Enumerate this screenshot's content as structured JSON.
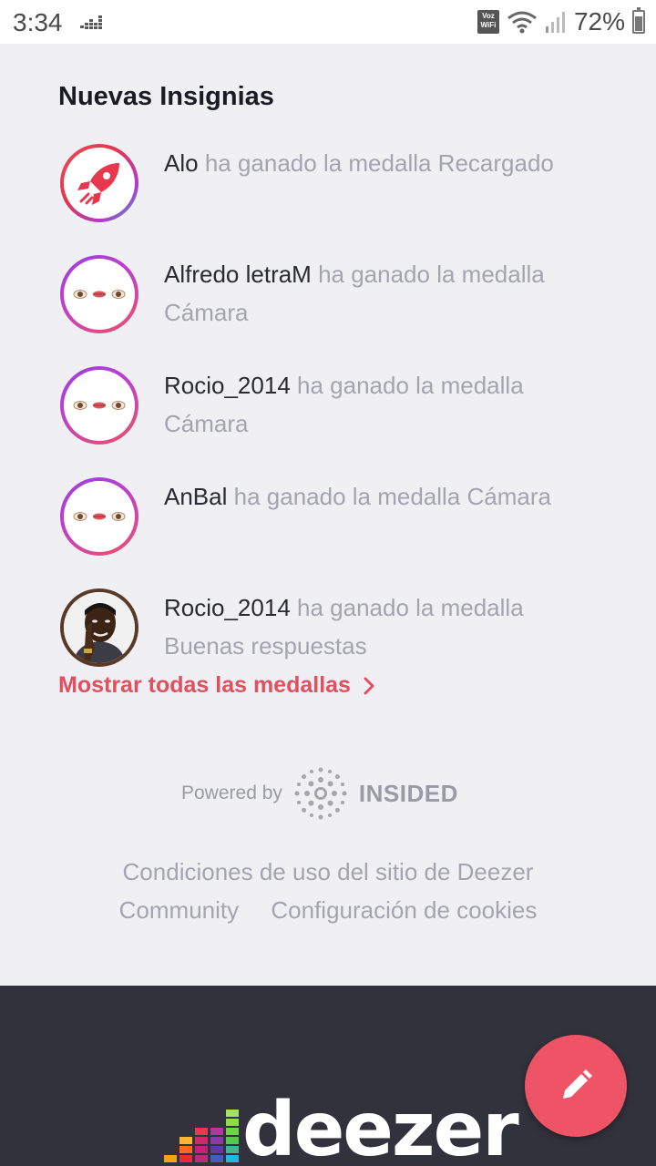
{
  "status_bar": {
    "time": "3:34",
    "volte_label": "Voz WiFi",
    "battery_percent": "72%",
    "icons": [
      "equalizer-icon",
      "volte-icon",
      "wifi-icon",
      "signal-icon",
      "battery-icon"
    ]
  },
  "section": {
    "title": "Nuevas Insignias"
  },
  "badges": [
    {
      "user": "Alo",
      "text": "ha ganado la medalla Recargado",
      "icon": "rocket-icon"
    },
    {
      "user": "Alfredo letraM",
      "text": "ha ganado la medalla Cámara",
      "icon": "eyes-mouth-icon"
    },
    {
      "user": "Rocio_2014",
      "text": "ha ganado la medalla Cámara",
      "icon": "eyes-mouth-icon"
    },
    {
      "user": "AnBal",
      "text": "ha ganado la medalla Cámara",
      "icon": "eyes-mouth-icon"
    },
    {
      "user": "Rocio_2014",
      "text": "ha ganado la medalla Buenas respuestas",
      "icon": "thinking-man-icon"
    }
  ],
  "show_all": {
    "label": "Mostrar todas las medallas"
  },
  "powered_by": {
    "label": "Powered by",
    "brand": "INSIDED"
  },
  "footer": {
    "link_terms": "Condiciones de uso del sitio de Deezer",
    "link_community": "Community",
    "link_cookies": "Configuración de cookies"
  },
  "bottom_bar": {
    "brand": "deezer",
    "fab_icon": "pencil-icon"
  },
  "colors": {
    "accent": "#e0505e",
    "background": "#efeff4",
    "bottom_bar": "#32323d",
    "fab": "#ef5466"
  }
}
